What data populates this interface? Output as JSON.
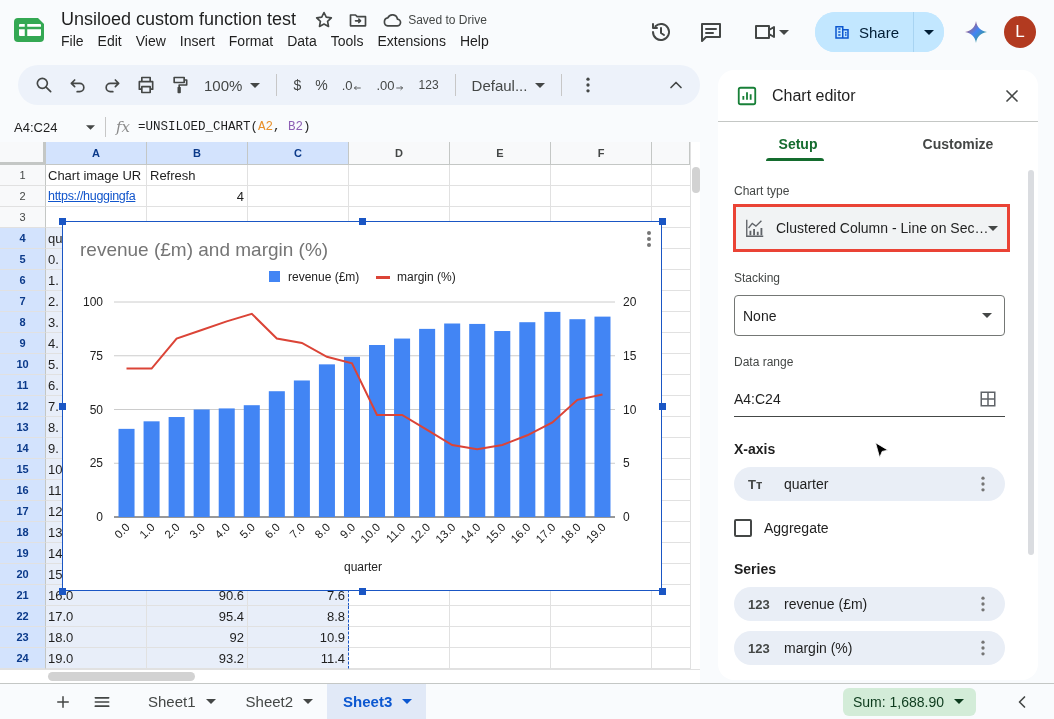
{
  "document": {
    "title": "Unsiloed custom function test",
    "save_status": "Saved to Drive"
  },
  "menu": [
    "File",
    "Edit",
    "View",
    "Insert",
    "Format",
    "Data",
    "Tools",
    "Extensions",
    "Help"
  ],
  "header_actions": {
    "share_label": "Share",
    "avatar_letter": "L"
  },
  "toolbar": {
    "zoom": "100%",
    "currency": "$",
    "percent": "%",
    "decrease_decimals": ".0",
    "increase_decimals": ".00",
    "number_format": "123",
    "font": "Defaul..."
  },
  "formula_bar": {
    "name_box": "A4:C24",
    "fx_label": "fx",
    "segments": [
      {
        "text": "=UNSILOED_CHART("
      },
      {
        "text": "A2",
        "color": "#e8912d"
      },
      {
        "text": ", "
      },
      {
        "text": "B2",
        "color": "#8e5fb5"
      },
      {
        "text": ")"
      }
    ]
  },
  "sheet": {
    "columns": [
      {
        "label": "A",
        "selected": true
      },
      {
        "label": "B",
        "selected": true
      },
      {
        "label": "C",
        "selected": true
      },
      {
        "label": "D",
        "selected": false
      },
      {
        "label": "E",
        "selected": false
      },
      {
        "label": "F",
        "selected": false
      }
    ],
    "rows": [
      {
        "label": "1",
        "selected": false,
        "cells": {
          "A": {
            "text": "Chart image UR",
            "kind": "text"
          },
          "B": {
            "text": "Refresh",
            "kind": "text"
          }
        }
      },
      {
        "label": "2",
        "selected": false,
        "cells": {
          "A": {
            "text": "https://huggingfa",
            "kind": "link"
          },
          "B": {
            "text": "4",
            "kind": "number"
          }
        }
      },
      {
        "label": "3",
        "selected": false
      },
      {
        "label": "4",
        "selected": true,
        "cells": {
          "A": {
            "text": "qu",
            "kind": "text"
          }
        }
      },
      {
        "label": "5",
        "selected": true,
        "cells": {
          "A": {
            "text": "0.",
            "kind": "text"
          }
        }
      },
      {
        "label": "6",
        "selected": true,
        "cells": {
          "A": {
            "text": "1.",
            "kind": "text"
          }
        }
      },
      {
        "label": "7",
        "selected": true,
        "cells": {
          "A": {
            "text": "2.",
            "kind": "text"
          }
        }
      },
      {
        "label": "8",
        "selected": true,
        "cells": {
          "A": {
            "text": "3.",
            "kind": "text"
          }
        }
      },
      {
        "label": "9",
        "selected": true,
        "cells": {
          "A": {
            "text": "4.",
            "kind": "text"
          }
        }
      },
      {
        "label": "10",
        "selected": true,
        "cells": {
          "A": {
            "text": "5.",
            "kind": "text"
          }
        }
      },
      {
        "label": "11",
        "selected": true,
        "cells": {
          "A": {
            "text": "6.",
            "kind": "text"
          }
        }
      },
      {
        "label": "12",
        "selected": true,
        "cells": {
          "A": {
            "text": "7.",
            "kind": "text"
          }
        }
      },
      {
        "label": "13",
        "selected": true,
        "cells": {
          "A": {
            "text": "8.",
            "kind": "text"
          }
        }
      },
      {
        "label": "14",
        "selected": true,
        "cells": {
          "A": {
            "text": "9.",
            "kind": "text"
          }
        }
      },
      {
        "label": "15",
        "selected": true,
        "cells": {
          "A": {
            "text": "10",
            "kind": "text"
          }
        }
      },
      {
        "label": "16",
        "selected": true,
        "cells": {
          "A": {
            "text": "11",
            "kind": "text"
          }
        }
      },
      {
        "label": "17",
        "selected": true,
        "cells": {
          "A": {
            "text": "12",
            "kind": "text"
          }
        }
      },
      {
        "label": "18",
        "selected": true,
        "cells": {
          "A": {
            "text": "13",
            "kind": "text"
          }
        }
      },
      {
        "label": "19",
        "selected": true,
        "cells": {
          "A": {
            "text": "14",
            "kind": "text"
          }
        }
      },
      {
        "label": "20",
        "selected": true,
        "cells": {
          "A": {
            "text": "15",
            "kind": "text"
          }
        }
      },
      {
        "label": "21",
        "selected": true,
        "cells": {
          "A": {
            "text": "16.0",
            "kind": "text"
          },
          "B": {
            "text": "90.6",
            "kind": "number"
          },
          "C": {
            "text": "7.6",
            "kind": "number"
          }
        }
      },
      {
        "label": "22",
        "selected": true,
        "cells": {
          "A": {
            "text": "17.0",
            "kind": "text"
          },
          "B": {
            "text": "95.4",
            "kind": "number"
          },
          "C": {
            "text": "8.8",
            "kind": "number"
          }
        }
      },
      {
        "label": "23",
        "selected": true,
        "cells": {
          "A": {
            "text": "18.0",
            "kind": "text"
          },
          "B": {
            "text": "92",
            "kind": "number"
          },
          "C": {
            "text": "10.9",
            "kind": "number"
          }
        }
      },
      {
        "label": "24",
        "selected": true,
        "cells": {
          "A": {
            "text": "19.0",
            "kind": "text"
          },
          "B": {
            "text": "93.2",
            "kind": "number"
          },
          "C": {
            "text": "11.4",
            "kind": "number"
          }
        }
      }
    ]
  },
  "chart": {
    "chart_data": {
      "type": "bar",
      "title": "revenue (£m) and margin (%)",
      "xlabel": "quarter",
      "categories": [
        "0.0",
        "1.0",
        "2.0",
        "3.0",
        "4.0",
        "5.0",
        "6.0",
        "7.0",
        "8.0",
        "9.0",
        "10.0",
        "11.0",
        "12.0",
        "13.0",
        "14.0",
        "15.0",
        "16.0",
        "17.0",
        "18.0",
        "19.0"
      ],
      "series": [
        {
          "name": "revenue (£m)",
          "color": "#4285f4",
          "type": "bar",
          "values": [
            41,
            44.5,
            46.5,
            50,
            50.5,
            52,
            58.5,
            63.5,
            71,
            74.5,
            80,
            83,
            87.5,
            90,
            89.8,
            86.5,
            90.6,
            95.4,
            92,
            93.2
          ]
        },
        {
          "name": "margin (%)",
          "color": "#db4437",
          "type": "line",
          "axis": "y2",
          "values": [
            13.8,
            13.8,
            16.6,
            17.4,
            18.2,
            18.9,
            16.6,
            16.2,
            14.9,
            14.3,
            9.5,
            9.5,
            8.1,
            6.7,
            6.3,
            6.7,
            7.6,
            8.8,
            10.9,
            11.4
          ]
        }
      ],
      "ylim": [
        0,
        100
      ],
      "yticks": [
        {
          "value": 0,
          "label": "0"
        },
        {
          "value": 25,
          "label": "25"
        },
        {
          "value": 50,
          "label": "50"
        },
        {
          "value": 75,
          "label": "75"
        },
        {
          "value": 100,
          "label": "100"
        }
      ],
      "y2lim": [
        0,
        20
      ],
      "y2ticks": [
        {
          "value": 0,
          "label": "0"
        },
        {
          "value": 5,
          "label": "5"
        },
        {
          "value": 10,
          "label": "10"
        },
        {
          "value": 15,
          "label": "15"
        },
        {
          "value": 20,
          "label": "20"
        }
      ],
      "grid": true,
      "legend": true
    }
  },
  "chart_editor": {
    "title": "Chart editor",
    "tabs": [
      {
        "label": "Setup",
        "selected": true
      },
      {
        "label": "Customize",
        "selected": false
      }
    ],
    "chart_type": {
      "label": "Chart type",
      "value": "Clustered Column - Line on Sec…",
      "highlighted": true
    },
    "stacking": {
      "label": "Stacking",
      "value": "None"
    },
    "data_range": {
      "label": "Data range",
      "value": "A4:C24"
    },
    "x_axis": {
      "heading": "X-axis",
      "items": [
        {
          "kind": "text",
          "icon_text": "Tт",
          "name": "quarter"
        }
      ]
    },
    "aggregate": {
      "label": "Aggregate",
      "checked": false
    },
    "series": {
      "heading": "Series",
      "items": [
        {
          "kind": "number",
          "icon_text": "123",
          "name": "revenue (£m)"
        },
        {
          "kind": "number",
          "icon_text": "123",
          "name": "margin (%)"
        }
      ]
    }
  },
  "sheet_tabs": [
    {
      "name": "Sheet1",
      "selected": false
    },
    {
      "name": "Sheet2",
      "selected": false
    },
    {
      "name": "Sheet3",
      "selected": true
    }
  ],
  "status": {
    "sum": "Sum: 1,688.90"
  }
}
